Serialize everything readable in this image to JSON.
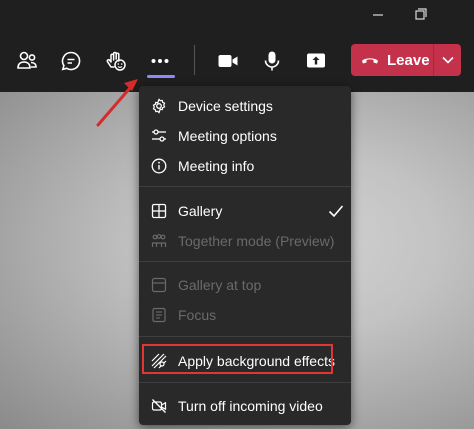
{
  "toolbar": {
    "leave_label": "Leave"
  },
  "menu": {
    "items": [
      {
        "label": "Device settings",
        "icon": "gear-icon"
      },
      {
        "label": "Meeting options",
        "icon": "sliders-icon"
      },
      {
        "label": "Meeting info",
        "icon": "info-icon"
      },
      {
        "label": "Gallery",
        "icon": "grid-icon"
      },
      {
        "label": "Together mode (Preview)",
        "icon": "people-icon"
      },
      {
        "label": "Gallery at top",
        "icon": "layout-top-icon"
      },
      {
        "label": "Focus",
        "icon": "focus-icon"
      },
      {
        "label": "Apply background effects",
        "icon": "background-effects-icon"
      },
      {
        "label": "Turn off incoming video",
        "icon": "video-off-icon"
      }
    ]
  },
  "colors": {
    "leave": "#c4314b",
    "accent_underline": "#8b8cf7",
    "highlight_box": "#e23636",
    "annotation_arrow": "#d62b2b"
  }
}
